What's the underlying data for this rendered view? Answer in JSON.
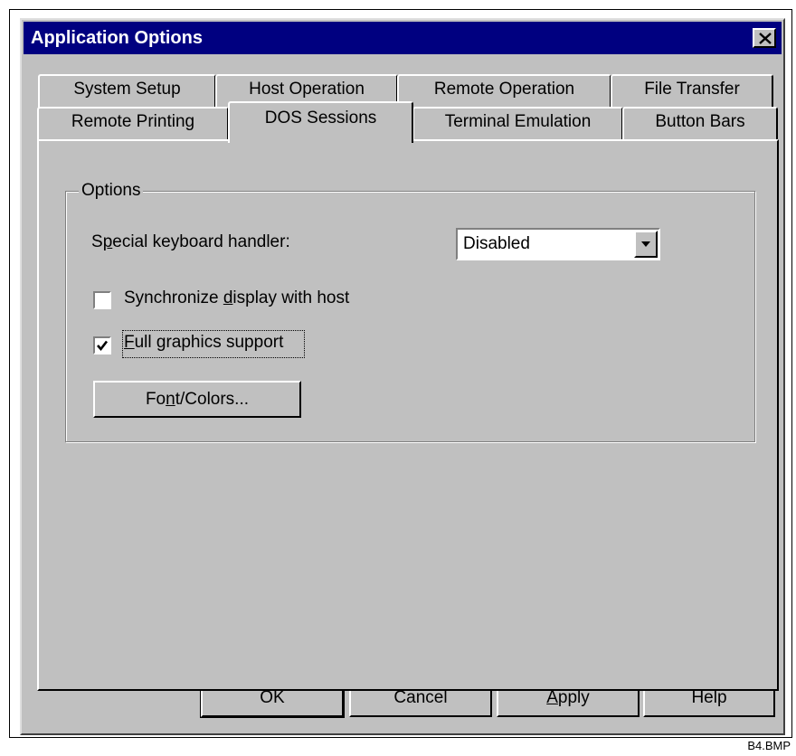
{
  "window": {
    "title": "Application Options",
    "close_icon": "close-icon"
  },
  "tabs": {
    "row_back": [
      {
        "label": "System Setup",
        "selected": false
      },
      {
        "label": "Host Operation",
        "selected": false
      },
      {
        "label": "Remote Operation",
        "selected": false
      },
      {
        "label": "File Transfer",
        "selected": false
      }
    ],
    "row_front": [
      {
        "label": "Remote Printing",
        "selected": false
      },
      {
        "label": "DOS Sessions",
        "selected": true
      },
      {
        "label": "Terminal Emulation",
        "selected": false
      },
      {
        "label": "Button Bars",
        "selected": false
      }
    ]
  },
  "options": {
    "group_title": "Options",
    "keyboard_handler": {
      "label_pre": "S",
      "label_mnemonic": "p",
      "label_post": "ecial keyboard handler:",
      "value": "Disabled"
    },
    "sync_display": {
      "label_pre": "Synchronize ",
      "label_mnemonic": "d",
      "label_post": "isplay with host",
      "checked": false
    },
    "full_graphics": {
      "label_pre": "",
      "label_mnemonic": "F",
      "label_post": "ull graphics support",
      "checked": true
    },
    "font_colors_button": {
      "label_pre": "Fo",
      "label_mnemonic": "n",
      "label_post": "t/Colors..."
    }
  },
  "buttons": {
    "ok": "OK",
    "cancel": "Cancel",
    "apply_mnemonic": "A",
    "apply_rest": "pply",
    "help": "Help"
  },
  "caption": "B4.BMP"
}
